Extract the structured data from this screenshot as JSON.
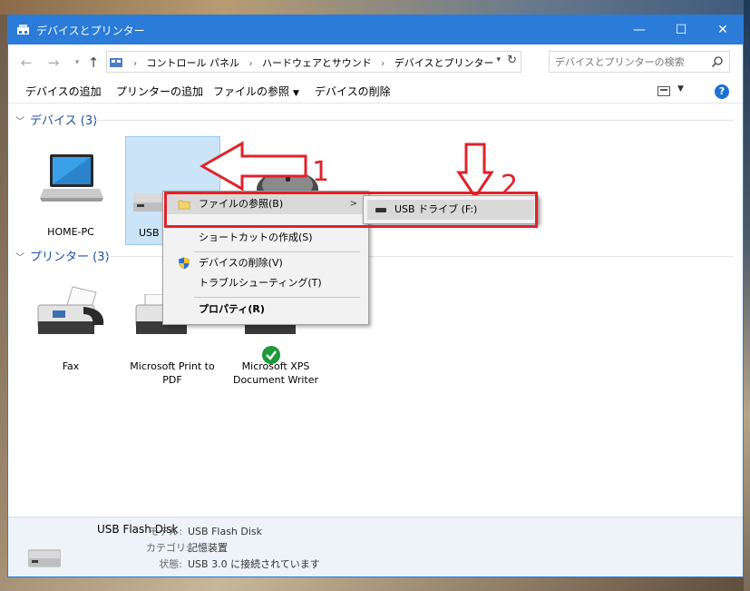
{
  "window": {
    "title": "デバイスとプリンター",
    "controls": {
      "minimize": "—",
      "maximize": "☐",
      "close": "✕"
    }
  },
  "address": {
    "crumbs": [
      "コントロール パネル",
      "ハードウェアとサウンド",
      "デバイスとプリンター"
    ],
    "search_placeholder": "デバイスとプリンターの検索"
  },
  "toolbar": {
    "add_device": "デバイスの追加",
    "add_printer": "プリンターの追加",
    "browse_files": "ファイルの参照",
    "remove_device": "デバイスの削除",
    "help": "?"
  },
  "groups": {
    "devices": {
      "header": "デバイス (3)"
    },
    "printers": {
      "header": "プリンター (3)"
    }
  },
  "devices": [
    {
      "name": "HOME-PC",
      "icon": "laptop-icon"
    },
    {
      "name": "USB F",
      "icon": "usb-drive-icon"
    },
    {
      "name": "",
      "icon": "mouse-icon"
    }
  ],
  "printers": [
    {
      "name": "Fax",
      "icon": "fax-icon"
    },
    {
      "name": "Microsoft Print to PDF",
      "icon": "printer-icon"
    },
    {
      "name": "Microsoft XPS Document Writer",
      "icon": "printer-icon"
    }
  ],
  "context_menu": {
    "items": [
      {
        "label": "ファイルの参照(B)",
        "icon": "folder-icon",
        "submenu": true,
        "highlighted": true
      },
      {
        "label": "ショートカットの作成(S)"
      },
      {
        "label": "デバイスの削除(V)",
        "icon": "shield-icon"
      },
      {
        "label": "トラブルシューティング(T)"
      },
      {
        "label": "プロパティ(R)",
        "bold": true
      }
    ],
    "submenu": [
      {
        "label": "USB ドライブ (F:)",
        "icon": "usb-drive-icon"
      }
    ]
  },
  "annotations": {
    "one": "1",
    "two": "2",
    "color": "#e0222a"
  },
  "details": {
    "name": "USB Flash Disk",
    "rows": [
      {
        "key": "モデル:",
        "value": "USB Flash Disk"
      },
      {
        "key": "カテゴリ:",
        "value": "記憶装置"
      },
      {
        "key": "状態:",
        "value": "USB 3.0 に接続されています"
      }
    ]
  },
  "colors": {
    "accent": "#2b7bd8",
    "group_header": "#1e4fa0",
    "selection": "#cce4f7",
    "details_bg": "#eef3fa"
  }
}
